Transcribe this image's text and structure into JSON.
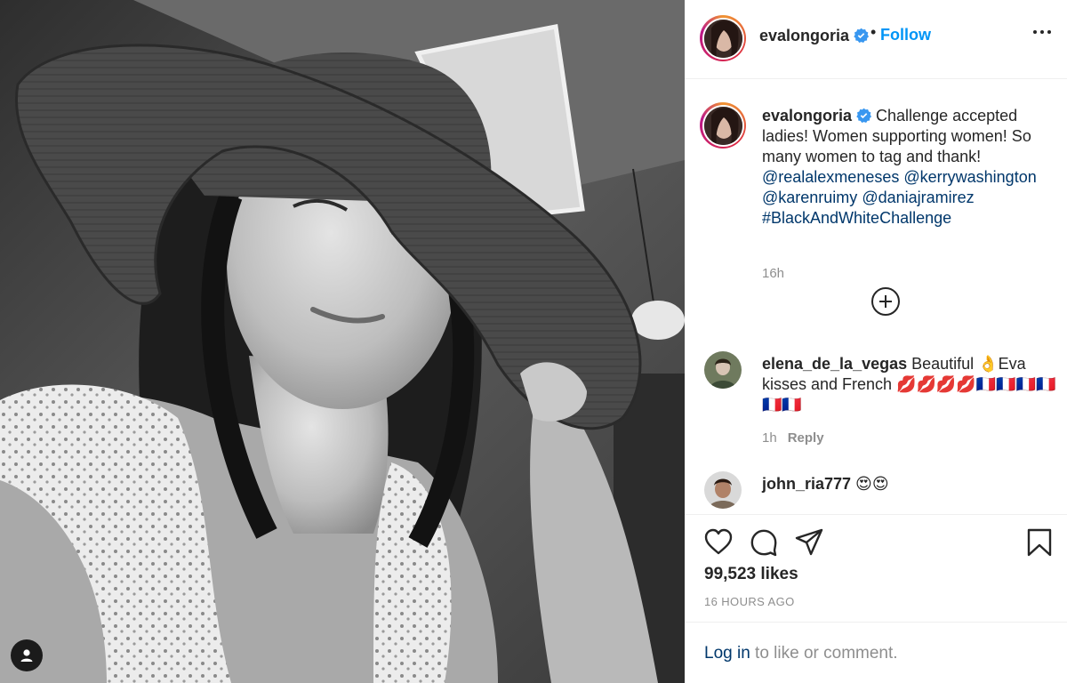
{
  "post": {
    "username": "evalongoria",
    "follow_label": "Follow",
    "dot": "•",
    "caption": {
      "username": "evalongoria",
      "text_1": " Challenge accepted ladies! Women supporting women! So many women to tag and thank! ",
      "mention_1": "@realalexmeneses",
      "mention_2": "@kerrywashington",
      "mention_3": "@karenruimy",
      "mention_4": "@daniajramirez",
      "hashtag": "#BlackAndWhiteChallenge",
      "time": "16h"
    },
    "comments": [
      {
        "username": "elena_de_la_vegas",
        "text": " Beautiful 👌Eva kisses and French 💋💋💋💋🇫🇷🇫🇷🇫🇷🇫🇷🇫🇷🇫🇷",
        "time": "1h",
        "reply_label": "Reply"
      },
      {
        "username": "john_ria777",
        "text": " 😍😍"
      }
    ],
    "likes": "99,523 likes",
    "time_ago": "16 HOURS AGO",
    "login_link": "Log in",
    "login_rest": " to like or comment."
  },
  "colors": {
    "follow": "#0095f6",
    "link": "#00376b",
    "muted": "#8e8e8e",
    "verified": "#3897f0"
  },
  "icons": [
    "user-tag-icon",
    "verified-icon",
    "more-options-icon",
    "load-more-icon",
    "heart-icon",
    "comment-icon",
    "share-icon",
    "bookmark-icon"
  ]
}
